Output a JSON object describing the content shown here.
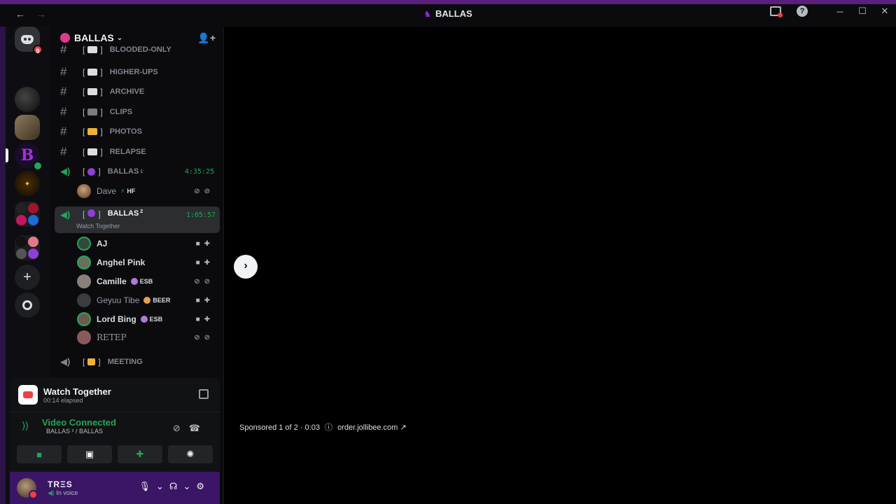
{
  "titlebar": {
    "back_icon": "←",
    "forward_icon": "→",
    "title": "BALLAS",
    "help": "?",
    "minimize": "─",
    "maximize": "☐",
    "close": "✕"
  },
  "rail": {
    "home_badge": "9"
  },
  "guild": {
    "name": "BALLAS",
    "chevron": "⌄",
    "invite_icon": "+"
  },
  "channels": [
    {
      "label": "BLOODED-ONLY"
    },
    {
      "label": "HIGHER-UPS"
    },
    {
      "label": "ARCHIVE"
    },
    {
      "label": "CLIPS"
    },
    {
      "label": "PHOTOS"
    },
    {
      "label": "RELAPSE"
    }
  ],
  "voice_channels": [
    {
      "label": "BALLAS",
      "sup": "1",
      "timer": "4:35:25"
    },
    {
      "label": "BALLAS",
      "sup": "2",
      "timer": "1:05:57",
      "activity": "Watch Together"
    },
    {
      "label": "MEETING"
    }
  ],
  "voice_users_1": [
    {
      "name": "Dave",
      "tag": "HF"
    }
  ],
  "voice_users_2": [
    {
      "name": "AJ"
    },
    {
      "name": "Anghel Pink"
    },
    {
      "name": "Camille",
      "tag": "ESB"
    },
    {
      "name": "Geyuu Tibe",
      "tag": "BEER"
    },
    {
      "name": "Lord Bing",
      "tag": "ESB"
    },
    {
      "name": "RETEP"
    }
  ],
  "activity_panel": {
    "title": "Watch Together",
    "elapsed": "00:14 elapsed"
  },
  "voice_status": {
    "title": "Video Connected",
    "location": "BALLAS ² / BALLAS"
  },
  "user": {
    "name": "TRΞS",
    "status": "In voice"
  },
  "main": {
    "next_icon": "›",
    "sponsor_text": "Sponsored 1 of 2 · 0:03",
    "sponsor_link": "order.jollibee.com"
  }
}
